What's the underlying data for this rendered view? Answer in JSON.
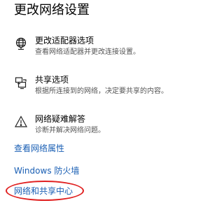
{
  "header": {
    "title": "更改网络设置"
  },
  "options": [
    {
      "icon": "globe-icon",
      "title": "更改适配器选项",
      "desc": "查看网络适配器并更改连接设置。"
    },
    {
      "icon": "sharing-icon",
      "title": "共享选项",
      "desc": "根据所连接到的网络，决定要共享的内容。"
    },
    {
      "icon": "warning-icon",
      "title": "网络疑难解答",
      "desc": "诊断并解决网络问题。"
    }
  ],
  "links": {
    "network_properties": "查看网络属性",
    "firewall": "Windows 防火墙",
    "sharing_center": "网络和共享中心"
  },
  "colors": {
    "link": "#1a5fb4",
    "highlight_circle": "#e02020"
  }
}
